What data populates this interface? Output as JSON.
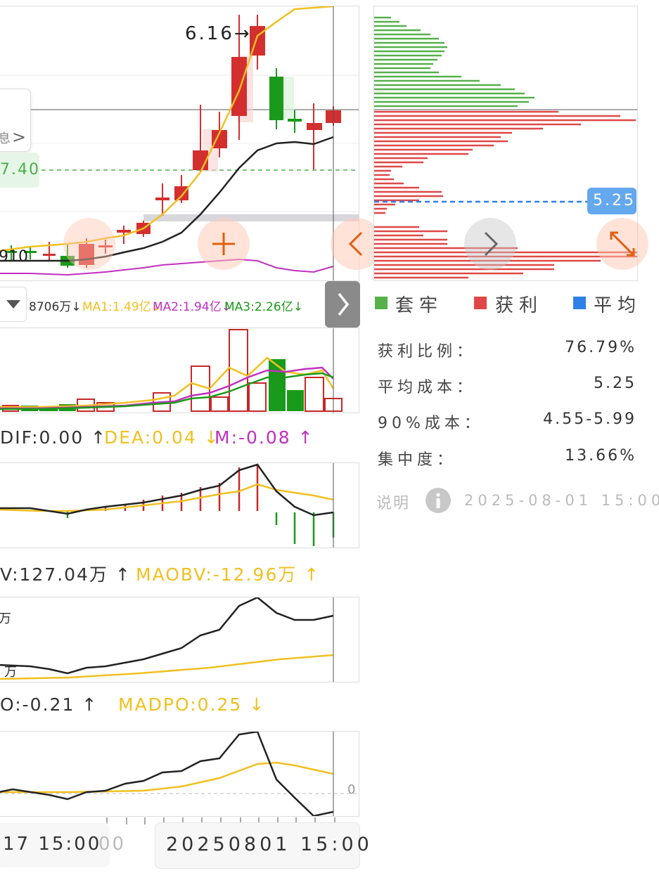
{
  "main_chart": {
    "high_label": "6.16→",
    "price_tag": "7.40",
    "left_price_tag": "910",
    "info_chevron": ">",
    "info_glyph": "息"
  },
  "volume_bar": {
    "text": "8706万↓",
    "ma1": "MA1:1.49亿↓",
    "ma2": "MA2:1.94亿↓",
    "ma3": "MA3:2.26亿↓"
  },
  "macd": {
    "dif": "DIF:0.00 ↑",
    "dea": "DEA:0.04 ↓",
    "m": "M:-0.08 ↑"
  },
  "obv": {
    "obv": "V:127.04万 ↑",
    "maobv": "MAOBV:-12.96万 ↑",
    "axis_top": "万",
    "axis_bottom": "万"
  },
  "dpo": {
    "dpo": "O:-0.21 ↑",
    "madpo": "MADPO:0.25 ↓",
    "zero_label": "0"
  },
  "time_axis": {
    "left_label": "17 15:00",
    "left_faded": "00",
    "cursor_time": "20250801 15:00"
  },
  "chip_distribution": {
    "avg_tag": "5.25",
    "legend": [
      {
        "label": "套牢",
        "color": "#55b14a"
      },
      {
        "label": "获利",
        "color": "#e04848"
      },
      {
        "label": "平均",
        "color": "#2f80e8"
      }
    ],
    "stats": [
      {
        "label": "获利比例：",
        "value": "76.79%"
      },
      {
        "label": "平均成本：",
        "value": "5.25"
      },
      {
        "label": "90%成本：",
        "value": "4.55-5.99"
      },
      {
        "label": "集中度：",
        "value": "13.66%"
      }
    ],
    "note_label": "说明",
    "note_date": "2025-08-01 15:00"
  },
  "colors": {
    "up": "#d32f2f",
    "down": "#1a9a1a",
    "ma_yellow": "#f0c020",
    "ma_magenta": "#c030c0",
    "ma_green": "#1a9a1a",
    "accent_orange": "#e06010"
  }
}
